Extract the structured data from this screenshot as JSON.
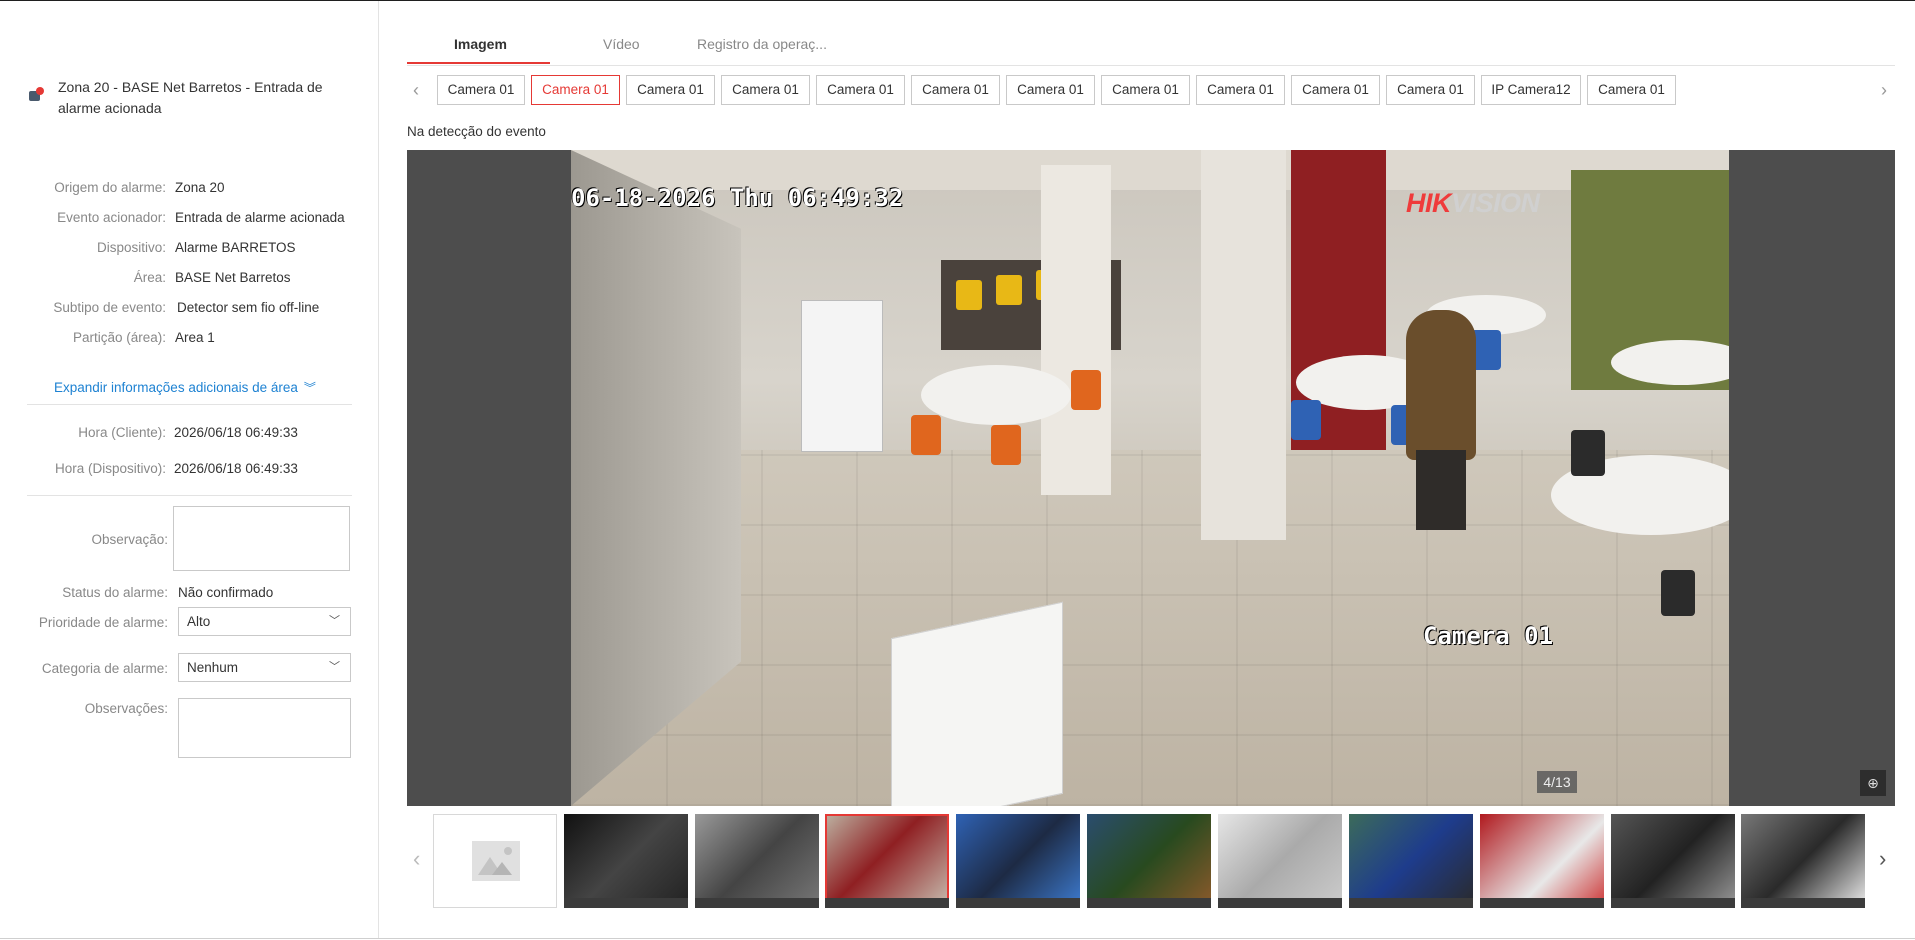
{
  "alarm": {
    "title": "Zona 20 - BASE Net Barretos - Entrada de alarme acionada"
  },
  "details": [
    {
      "label": "Origem do alarme:",
      "value": "Zona 20"
    },
    {
      "label": "Evento acionador:",
      "value": "Entrada de alarme acionada"
    },
    {
      "label": "Dispositivo:",
      "value": "Alarme BARRETOS"
    },
    {
      "label": "Área:",
      "value": "BASE Net Barretos"
    },
    {
      "label": "Subtipo de evento:",
      "value": "Detector sem fio off-line"
    },
    {
      "label": "Partição (área):",
      "value": "Area 1"
    }
  ],
  "expand_label": "Expandir informações adicionais de área",
  "times": [
    {
      "label": "Hora (Cliente):",
      "value": "2026/06/18 06:49:33"
    },
    {
      "label": "Hora (Dispositivo):",
      "value": "2026/06/18 06:49:33"
    }
  ],
  "form": {
    "observacao_label": "Observação:",
    "observacao_value": "",
    "status_label": "Status do alarme:",
    "status_value": "Não confirmado",
    "priority_label": "Prioridade de alarme:",
    "priority_value": "Alto",
    "category_label": "Categoria de alarme:",
    "category_value": "Nenhum",
    "observacoes_label": "Observações:",
    "observacoes_value": ""
  },
  "tabs": [
    {
      "label": "Imagem",
      "active": true
    },
    {
      "label": "Vídeo",
      "active": false
    },
    {
      "label": "Registro da operaç...",
      "active": false
    }
  ],
  "cameras": [
    "Camera 01",
    "Camera 01",
    "Camera 01",
    "Camera 01",
    "Camera 01",
    "Camera 01",
    "Camera 01",
    "Camera 01",
    "Camera 01",
    "Camera 01",
    "Camera 01",
    "IP Camera12",
    "Camera 01"
  ],
  "active_camera_index": 1,
  "caption": "Na detecção do evento",
  "viewer": {
    "osd_timestamp": "06-18-2026 Thu 06:49:32",
    "osd_camera": "Camera 01",
    "brand_red": "HIK",
    "brand_rest": "VISION",
    "counter": "4/13"
  },
  "icons": {
    "alarm": "alarm-bell-icon",
    "prev": "chevron-left-icon",
    "next": "chevron-right-icon",
    "zoom": "zoom-in-icon",
    "expand": "double-chevron-down-icon",
    "placeholder": "image-placeholder-icon"
  },
  "colors": {
    "accent": "#e53935",
    "link": "#1e82d2"
  },
  "thumbnails": {
    "count": 11,
    "active_index": 3
  }
}
